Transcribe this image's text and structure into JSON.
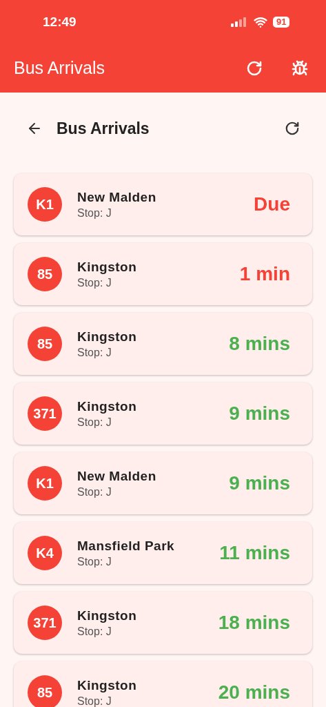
{
  "status_bar": {
    "time": "12:49",
    "battery": "91"
  },
  "app_bar": {
    "title": "Bus Arrivals"
  },
  "header": {
    "title": "Bus Arrivals"
  },
  "arrivals": [
    {
      "route": "K1",
      "destination": "New Malden",
      "stop": "Stop: J",
      "eta": "Due",
      "color": "#f44336"
    },
    {
      "route": "85",
      "destination": "Kingston",
      "stop": "Stop: J",
      "eta": "1 min",
      "color": "#f44336"
    },
    {
      "route": "85",
      "destination": "Kingston",
      "stop": "Stop: J",
      "eta": "8 mins",
      "color": "#4caf50"
    },
    {
      "route": "371",
      "destination": "Kingston",
      "stop": "Stop: J",
      "eta": "9 mins",
      "color": "#4caf50"
    },
    {
      "route": "K1",
      "destination": "New Malden",
      "stop": "Stop: J",
      "eta": "9 mins",
      "color": "#4caf50"
    },
    {
      "route": "K4",
      "destination": "Mansfield Park",
      "stop": "Stop: J",
      "eta": "11 mins",
      "color": "#4caf50"
    },
    {
      "route": "371",
      "destination": "Kingston",
      "stop": "Stop: J",
      "eta": "18 mins",
      "color": "#4caf50"
    },
    {
      "route": "85",
      "destination": "Kingston",
      "stop": "Stop: J",
      "eta": "20 mins",
      "color": "#4caf50"
    }
  ]
}
